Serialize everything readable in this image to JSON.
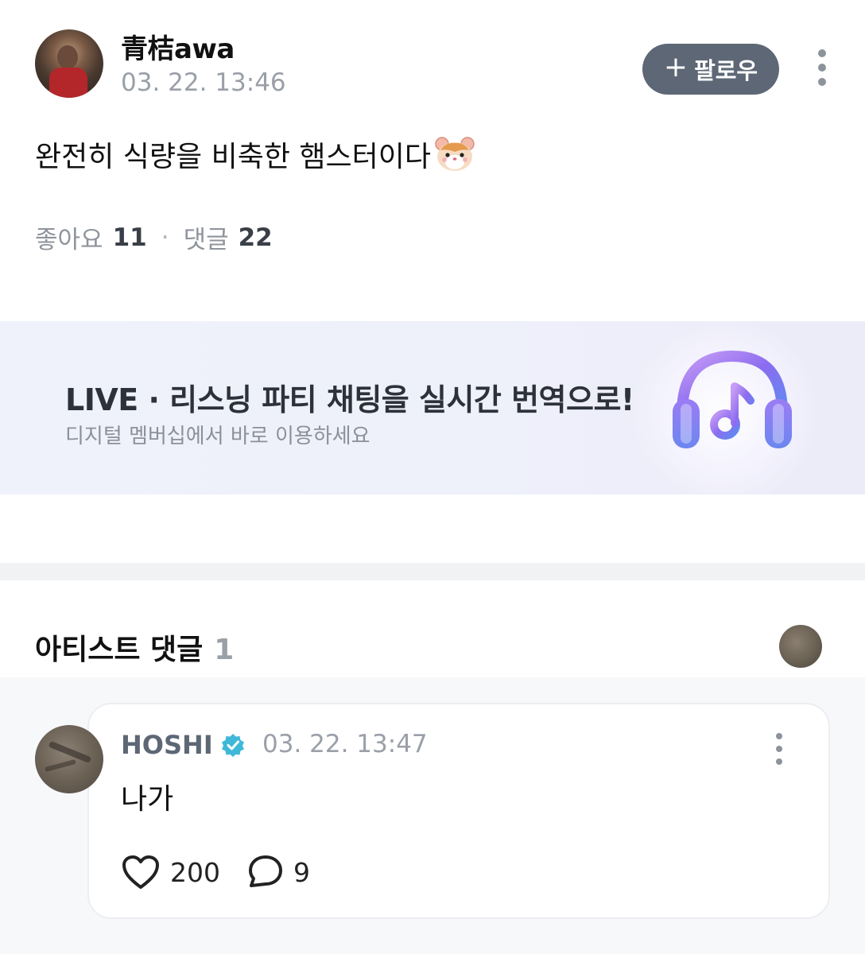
{
  "post": {
    "author_name": "青桔awa",
    "timestamp": "03. 22. 13:46",
    "follow_label": "팔로우",
    "body": "완전히 식량을 비축한 햄스터이다",
    "emoji_icon": "hamster-face-icon",
    "stats": {
      "likes_label": "좋아요",
      "likes_count": "11",
      "comments_label": "댓글",
      "comments_count": "22"
    }
  },
  "banner": {
    "title": "LIVE · 리스닝 파티 채팅을 실시간 번역으로!",
    "subtitle": "디지털 멤버십에서 바로 이용하세요",
    "icon": "headphones-music-note-icon",
    "accent_color": "#8b6cf0"
  },
  "artist_comments": {
    "heading": "아티스트 댓글",
    "count": "1",
    "items": [
      {
        "name": "HOSHI",
        "verified_icon": "verified-badge-icon",
        "timestamp": "03. 22. 13:47",
        "text": "나가",
        "likes": "200",
        "replies": "9"
      }
    ]
  },
  "colors": {
    "follow_button_bg": "#5d6775",
    "verified_badge": "#3fb8d8",
    "muted_text": "#9a9fa8"
  }
}
